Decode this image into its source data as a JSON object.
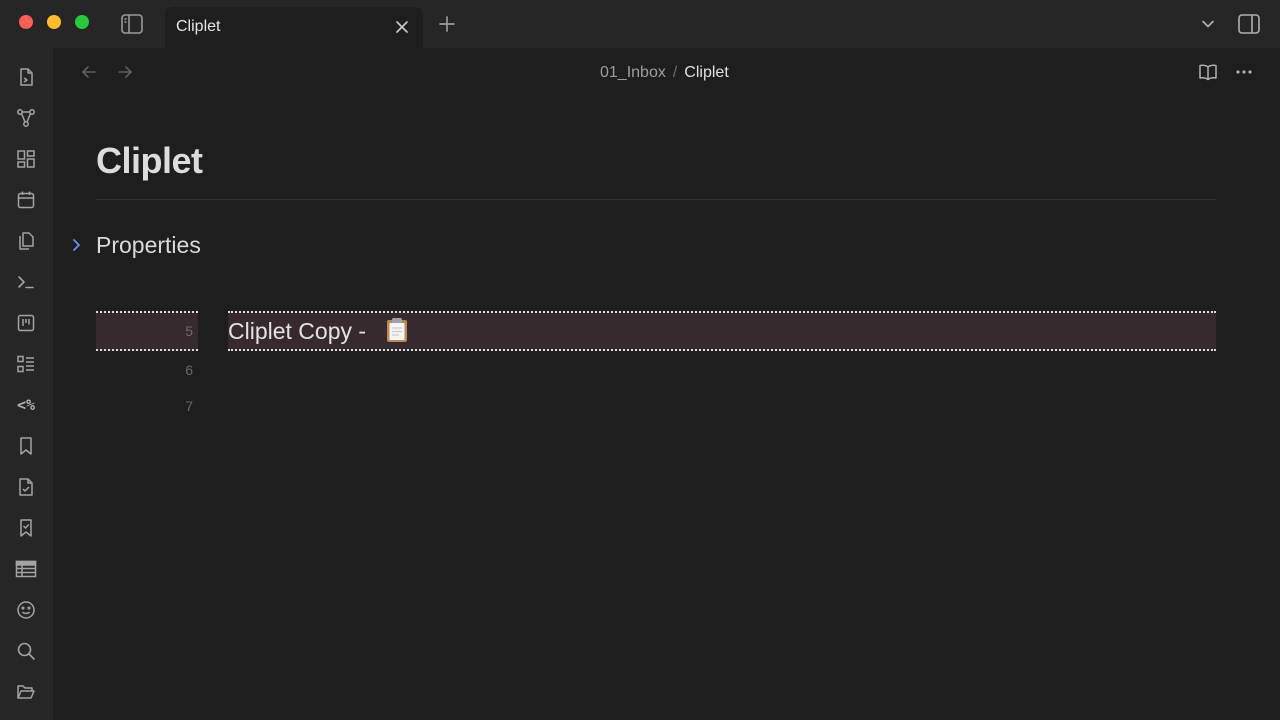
{
  "tab": {
    "title": "Cliplet"
  },
  "breadcrumb": {
    "folder": "01_Inbox",
    "separator": "/",
    "file": "Cliplet"
  },
  "note": {
    "title": "Cliplet",
    "properties_label": "Properties",
    "lines": [
      {
        "number": "5",
        "text": "Cliplet Copy - ",
        "emoji": "clipboard-emoji"
      },
      {
        "number": "6",
        "text": ""
      },
      {
        "number": "7",
        "text": ""
      }
    ]
  },
  "ribbon": {
    "items": [
      "open-quick-switcher-icon",
      "graph-view-icon",
      "canvas-icon",
      "calendar-icon",
      "copy-files-icon",
      "terminal-icon",
      "kanban-icon",
      "checklist-icon",
      "templater-icon",
      "bookmark-icon",
      "tasks-file-icon",
      "bookmark-check-icon",
      "table-icon",
      "emoji-icon",
      "search-icon",
      "folder-open-icon"
    ],
    "templater_label": "<%"
  },
  "colors": {
    "background": "#1e1e1e",
    "chrome": "#262626",
    "accent": "#6e8ef5",
    "highlight": "#372a2e"
  }
}
